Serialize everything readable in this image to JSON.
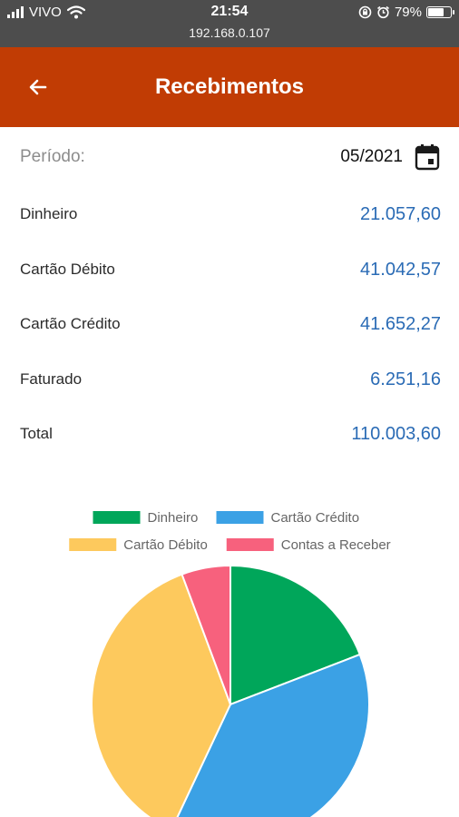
{
  "status_bar": {
    "carrier": "VIVO",
    "time": "21:54",
    "url": "192.168.0.107",
    "battery": "79%",
    "battery_level": 0.79,
    "icons": [
      "signal-icon",
      "wifi-icon",
      "lock-rotation-icon",
      "alarm-icon",
      "battery-icon"
    ]
  },
  "header": {
    "title": "Recebimentos",
    "back_icon": "arrow-left-icon",
    "background_color": "#c13c04"
  },
  "period": {
    "label": "Período:",
    "value": "05/2021",
    "icon": "calendar-icon"
  },
  "summary": [
    {
      "label": "Dinheiro",
      "value": "21.057,60"
    },
    {
      "label": "Cartão Débito",
      "value": "41.042,57"
    },
    {
      "label": "Cartão Crédito",
      "value": "41.652,27"
    },
    {
      "label": "Faturado",
      "value": "6.251,16"
    },
    {
      "label": "Total",
      "value": "110.003,60"
    }
  ],
  "value_color": "#2a6bb5",
  "chart_data": {
    "type": "pie",
    "legend_position": "top",
    "series": [
      {
        "name": "Dinheiro",
        "value": 21057.6,
        "color": "#00a65a"
      },
      {
        "name": "Cartão Crédito",
        "value": 41652.27,
        "color": "#3ba1e5"
      },
      {
        "name": "Cartão Débito",
        "value": 41042.57,
        "color": "#fdc95d"
      },
      {
        "name": "Contas a Receber",
        "value": 6251.16,
        "color": "#f7617d"
      }
    ]
  }
}
